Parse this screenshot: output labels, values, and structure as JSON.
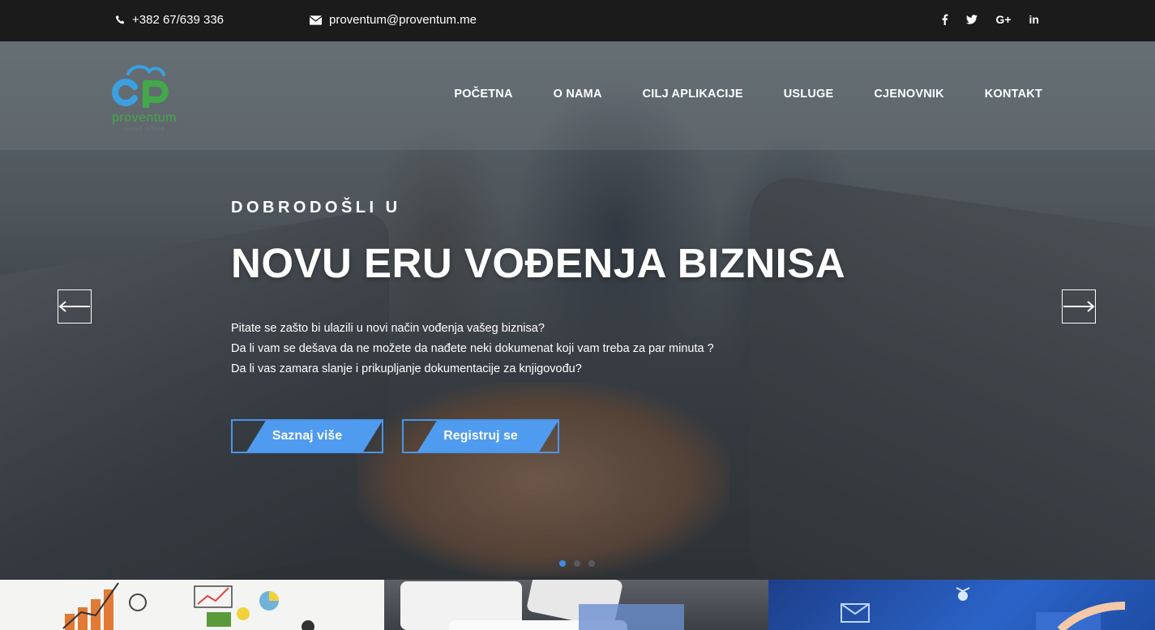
{
  "topbar": {
    "phone": "+382 67/639 336",
    "email": "proventum@proventum.me",
    "social": [
      {
        "icon": "facebook-icon",
        "glyph": "f"
      },
      {
        "icon": "twitter-icon",
        "glyph": "t"
      },
      {
        "icon": "google-plus-icon",
        "glyph": "G+"
      },
      {
        "icon": "linkedin-icon",
        "glyph": "in"
      }
    ]
  },
  "logo": {
    "brand": "proventum",
    "tagline": "cloud office"
  },
  "nav": {
    "items": [
      "POČETNA",
      "O NAMA",
      "CILJ APLIKACIJE",
      "USLUGE",
      "CJENOVNIK",
      "KONTAKT"
    ]
  },
  "hero": {
    "kicker": "DOBRODOŠLI U",
    "title": "NOVU ERU VOĐENJA BIZNISA",
    "lines": [
      "Pitate se zašto bi ulazili u novi način vođenja vašeg biznisa?",
      "Da li vam se dešava da ne možete da nađete neki dokumenat koji vam treba za par minuta ?",
      "Da li vas zamara slanje i prikupljanje dokumentacije za knjigovođu?"
    ],
    "cta_primary": "Saznaj više",
    "cta_secondary": "Registruj se",
    "slides_total": 3,
    "active_slide": 1
  },
  "colors": {
    "accent": "#4f9bef",
    "topbar_bg": "#1b1b1b",
    "logo_blue": "#3aa0e0",
    "logo_green": "#41a84b"
  }
}
